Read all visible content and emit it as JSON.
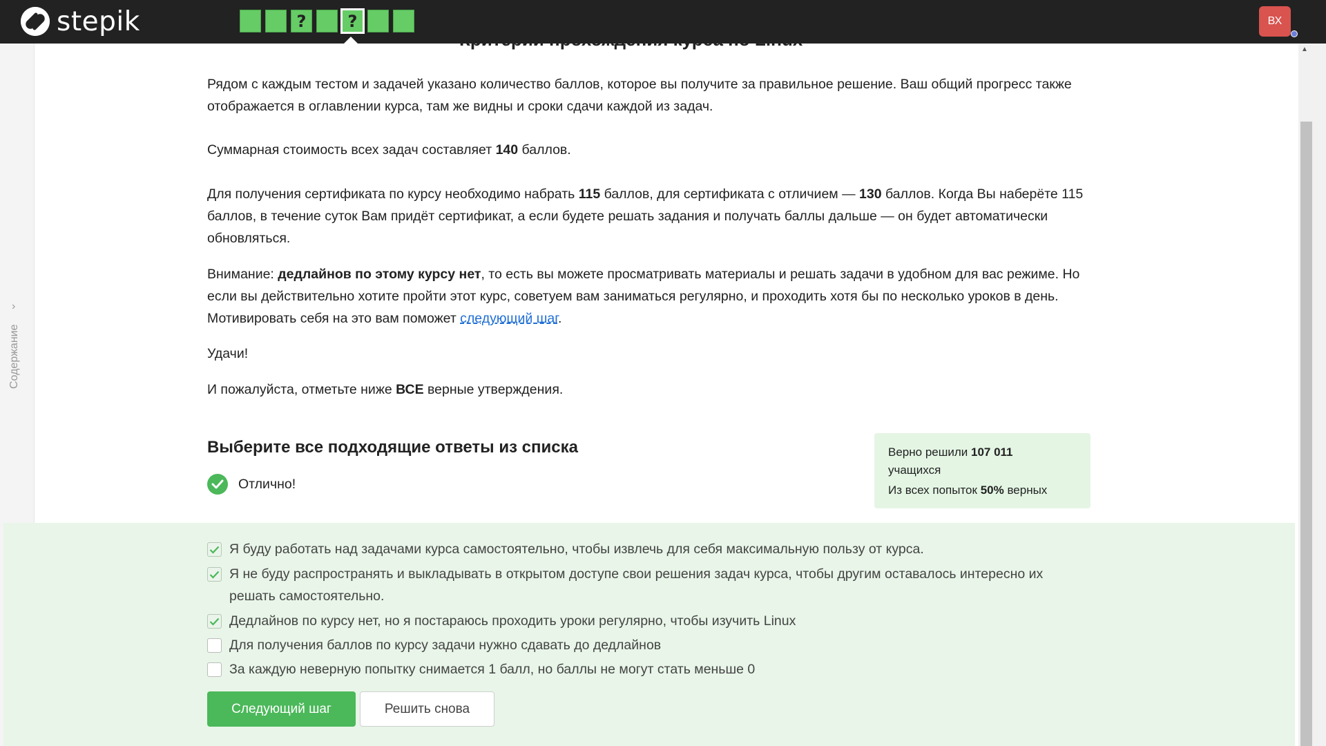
{
  "header": {
    "logo_text": "stepik",
    "steps": [
      {
        "label": "",
        "type": "text"
      },
      {
        "label": "",
        "type": "text"
      },
      {
        "label": "?",
        "type": "quiz"
      },
      {
        "label": "",
        "type": "text"
      },
      {
        "label": "?",
        "type": "quiz",
        "active": true
      },
      {
        "label": "",
        "type": "text"
      },
      {
        "label": "",
        "type": "text"
      }
    ],
    "avatar_initials": "ВХ",
    "accent_color": "#66cc66"
  },
  "sidebar": {
    "toc_label": "Содержание",
    "chevron": "›"
  },
  "lesson": {
    "title_cut": "Критерии прохождения курса по Linux",
    "p1": "Рядом с каждым тестом и задачей указано количество баллов, которое вы получите за правильное решение. Ваш общий прогресс также отображается в оглавлении курса, там же видны и сроки сдачи каждой из задач.",
    "p2_pre": "Суммарная стоимость всех задач составляет ",
    "p2_bold": "140",
    "p2_post": " баллов.",
    "p3_pre": "Для получения сертификата по курсу необходимо набрать ",
    "p3_bold1": "115",
    "p3_mid": " баллов, для сертификата с отличием — ",
    "p3_bold2": "130",
    "p3_post": " баллов. Когда Вы наберёте 115 баллов, в течение суток Вам придёт сертификат, а если будете решать задания и получать баллы дальше — он будет автоматически обновляться.",
    "p4_pre": "Внимание: ",
    "p4_bold": "дедлайнов по этому курсу нет",
    "p4_mid": ", то есть вы можете просматривать материалы и решать задачи в удобном для вас режиме. Но если вы действительно хотите пройти этот курс, советуем вам заниматься регулярно, и проходить хотя бы по несколько уроков в день. Мотивировать себя на это вам поможет ",
    "p4_link": "следующий шаг",
    "p4_post": ".",
    "p5": "Удачи!",
    "p6_pre": "И пожалуйста, отметьте ниже ",
    "p6_bold": "ВСЕ",
    "p6_post": " верные утверждения."
  },
  "quiz": {
    "title": "Выберите все подходящие ответы из списка",
    "result_text": "Отлично!",
    "stats": {
      "solved_pre": "Верно решили ",
      "solved_count": "107 011",
      "solved_post": "учащихся",
      "attempts_pre": "Из всех попыток ",
      "attempts_pct": "50%",
      "attempts_post": " верных"
    },
    "options": [
      {
        "label": "Я буду работать над задачами курса самостоятельно, чтобы извлечь для себя максимальную пользу от курса.",
        "checked": true
      },
      {
        "label": "Я не буду распространять и выкладывать в открытом доступе свои решения задач курса, чтобы другим оставалось интересно их решать самостоятельно.",
        "checked": true
      },
      {
        "label": "Дедлайнов по курсу нет, но я постараюсь проходить уроки регулярно, чтобы изучить Linux",
        "checked": true
      },
      {
        "label": "Для получения баллов по курсу задачи нужно сдавать до дедлайнов",
        "checked": false
      },
      {
        "label": "За каждую неверную попытку снимается 1 балл, но баллы не могут стать меньше 0",
        "checked": false
      }
    ],
    "next_button": "Следующий шаг",
    "retry_button": "Решить снова"
  }
}
